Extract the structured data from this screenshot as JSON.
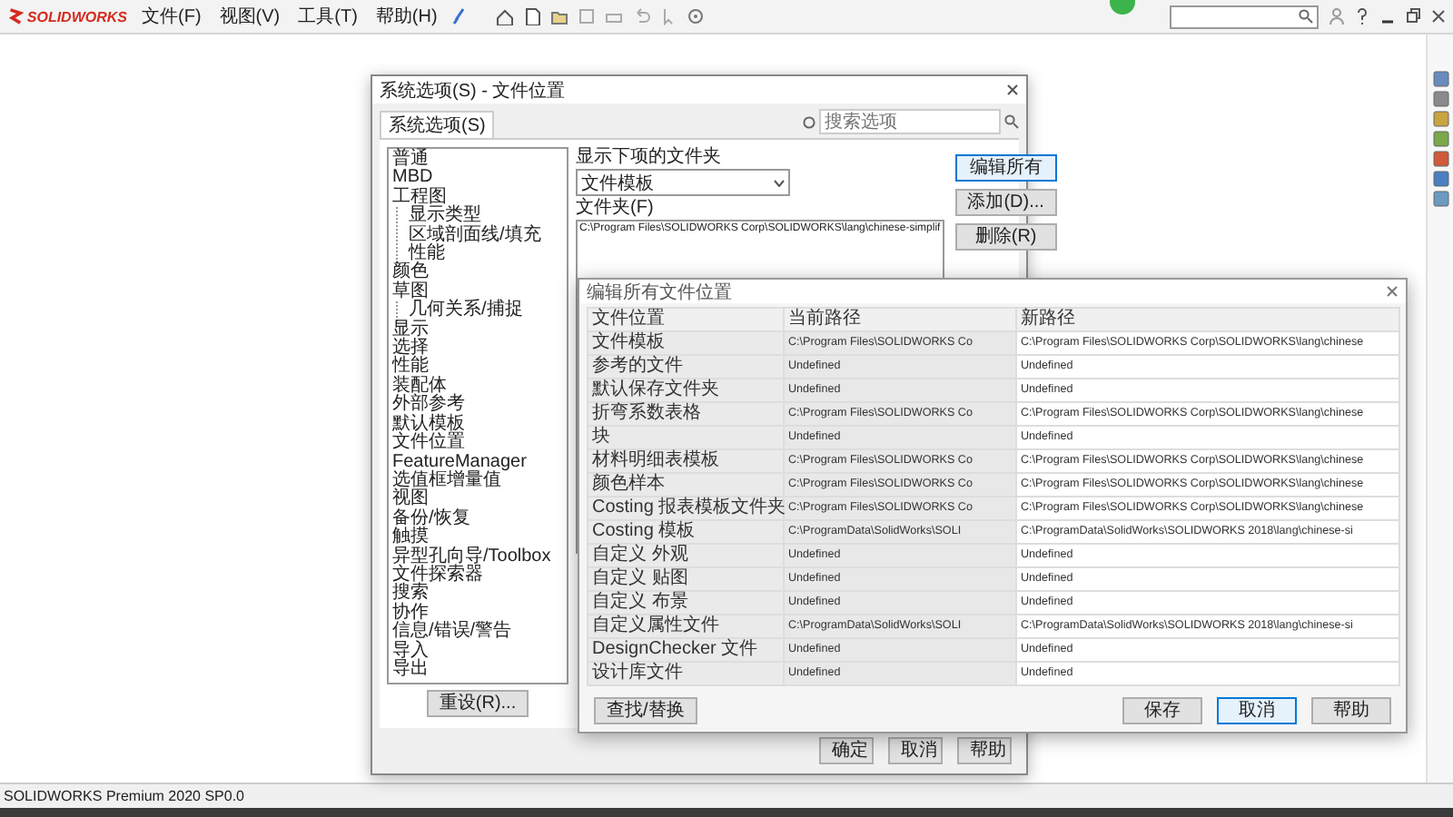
{
  "app": {
    "logo": "SOLIDWORKS",
    "menus": [
      "文件(F)",
      "视图(V)",
      "工具(T)",
      "帮助(H)"
    ],
    "status_bar": "SOLIDWORKS Premium 2020 SP0.0"
  },
  "options_dialog": {
    "title": "系统选项(S) - 文件位置",
    "tab": "系统选项(S)",
    "search": {
      "placeholder": "搜索选项"
    },
    "categories": [
      {
        "label": "普通"
      },
      {
        "label": "MBD"
      },
      {
        "label": "工程图",
        "children": [
          {
            "label": "显示类型"
          },
          {
            "label": "区域剖面线/填充"
          },
          {
            "label": "性能"
          }
        ]
      },
      {
        "label": "颜色"
      },
      {
        "label": "草图",
        "children": [
          {
            "label": "几何关系/捕捉"
          }
        ]
      },
      {
        "label": "显示"
      },
      {
        "label": "选择"
      },
      {
        "label": "性能"
      },
      {
        "label": "装配体"
      },
      {
        "label": "外部参考"
      },
      {
        "label": "默认模板"
      },
      {
        "label": "文件位置"
      },
      {
        "label": "FeatureManager"
      },
      {
        "label": "选值框增量值"
      },
      {
        "label": "视图"
      },
      {
        "label": "备份/恢复"
      },
      {
        "label": "触摸"
      },
      {
        "label": "异型孔向导/Toolbox"
      },
      {
        "label": "文件探索器"
      },
      {
        "label": "搜索"
      },
      {
        "label": "协作"
      },
      {
        "label": "信息/错误/警告"
      },
      {
        "label": "导入"
      },
      {
        "label": "导出"
      }
    ],
    "reset_button": "重设(R)...",
    "folder_select": {
      "label": "显示下项的文件夹",
      "value": "文件模板"
    },
    "folders_label": "文件夹(F)",
    "folders": [
      "C:\\Program Files\\SOLIDWORKS Corp\\SOLIDWORKS\\lang\\chinese-simplif"
    ],
    "side_buttons": [
      {
        "label": "编辑所有",
        "default": true
      },
      {
        "label": "添加(D)...",
        "default": false
      },
      {
        "label": "删除(R)",
        "default": false
      }
    ],
    "buttons": [
      "确定",
      "取消",
      "帮助"
    ]
  },
  "edit_all_dialog": {
    "title": "编辑所有文件位置",
    "columns": [
      "文件位置",
      "当前路径",
      "新路径"
    ],
    "rows": [
      [
        "文件模板",
        "C:\\Program Files\\SOLIDWORKS Co",
        "C:\\Program Files\\SOLIDWORKS Corp\\SOLIDWORKS\\lang\\chinese"
      ],
      [
        "参考的文件",
        "Undefined",
        "Undefined"
      ],
      [
        "默认保存文件夹",
        "Undefined",
        "Undefined"
      ],
      [
        "折弯系数表格",
        "C:\\Program Files\\SOLIDWORKS Co",
        "C:\\Program Files\\SOLIDWORKS Corp\\SOLIDWORKS\\lang\\chinese"
      ],
      [
        "块",
        "Undefined",
        "Undefined"
      ],
      [
        "材料明细表模板",
        "C:\\Program Files\\SOLIDWORKS Co",
        "C:\\Program Files\\SOLIDWORKS Corp\\SOLIDWORKS\\lang\\chinese"
      ],
      [
        "颜色样本",
        "C:\\Program Files\\SOLIDWORKS Co",
        "C:\\Program Files\\SOLIDWORKS Corp\\SOLIDWORKS\\lang\\chinese"
      ],
      [
        "Costing 报表模板文件夹",
        "C:\\Program Files\\SOLIDWORKS Co",
        "C:\\Program Files\\SOLIDWORKS Corp\\SOLIDWORKS\\lang\\chinese"
      ],
      [
        "Costing 模板",
        "C:\\ProgramData\\SolidWorks\\SOLI",
        "C:\\ProgramData\\SolidWorks\\SOLIDWORKS 2018\\lang\\chinese-si"
      ],
      [
        "自定义 外观",
        "Undefined",
        "Undefined"
      ],
      [
        "自定义 贴图",
        "Undefined",
        "Undefined"
      ],
      [
        "自定义 布景",
        "Undefined",
        "Undefined"
      ],
      [
        "自定义属性文件",
        "C:\\ProgramData\\SolidWorks\\SOLI",
        "C:\\ProgramData\\SolidWorks\\SOLIDWORKS 2018\\lang\\chinese-si"
      ],
      [
        "DesignChecker 文件",
        "Undefined",
        "Undefined"
      ],
      [
        "设计库文件",
        "Undefined",
        "Undefined"
      ]
    ],
    "find_button": "查找/替换",
    "buttons": [
      {
        "label": "保存",
        "default": false
      },
      {
        "label": "取消",
        "default": true
      },
      {
        "label": "帮助",
        "default": false
      }
    ]
  }
}
